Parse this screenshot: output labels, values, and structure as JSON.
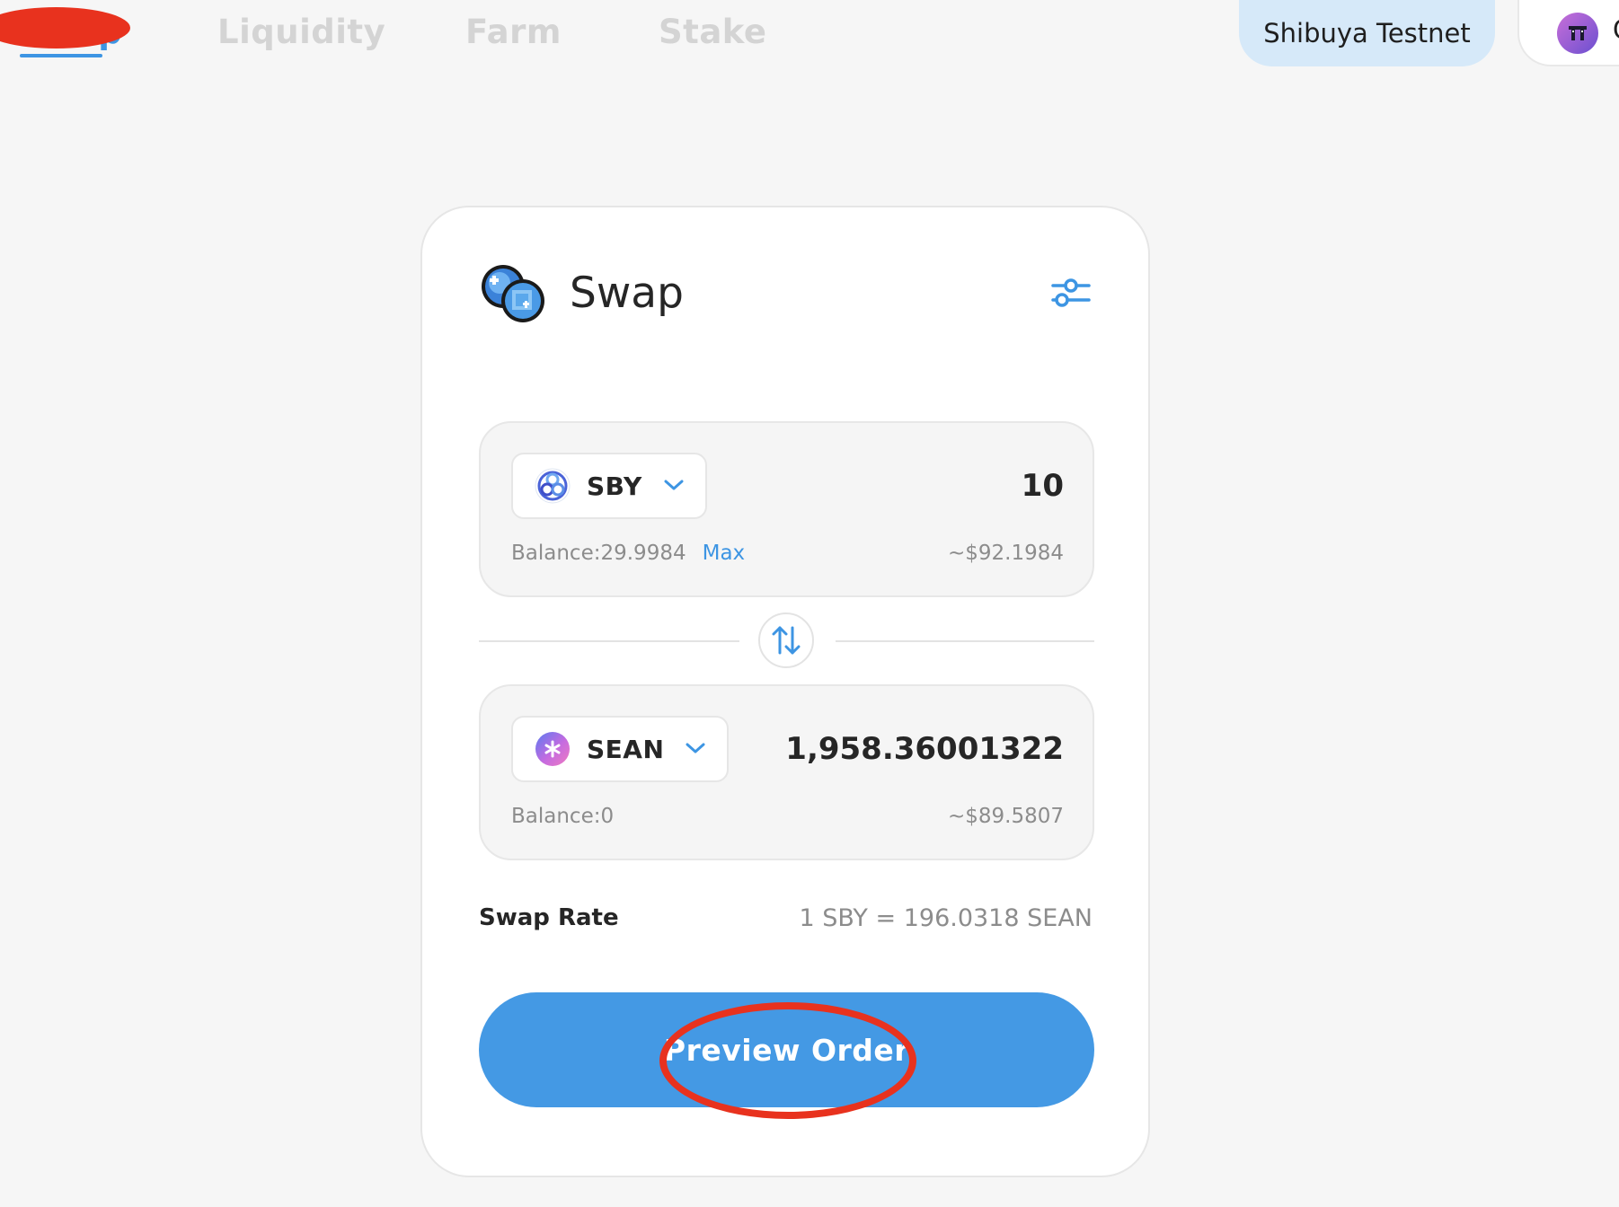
{
  "nav": {
    "tabs": [
      {
        "label": "Swap",
        "active": true
      },
      {
        "label": "Liquidity",
        "active": false
      },
      {
        "label": "Farm",
        "active": false
      },
      {
        "label": "Stake",
        "active": false
      }
    ],
    "network_label": "Shibuya Testnet",
    "wallet_label": "C"
  },
  "swap": {
    "title": "Swap",
    "from": {
      "symbol": "SBY",
      "amount": "10",
      "balance": "Balance:29.9984",
      "max_label": "Max",
      "usd_value": "~$92.1984"
    },
    "to": {
      "symbol": "SEAN",
      "amount": "1,958.36001322",
      "balance": "Balance:0",
      "usd_value": "~$89.5807"
    },
    "rate_label": "Swap Rate",
    "rate_value": "1 SBY = 196.0318 SEAN",
    "preview_button": "Preview Order"
  },
  "icons": {
    "settings": "sliders-icon",
    "flip": "swap-arrows-icon",
    "chevron": "chevron-down-icon",
    "sby": "shiden-token-icon",
    "sean": "sean-token-icon"
  },
  "colors": {
    "accent": "#3d95e3",
    "button": "#4499e4",
    "annotation": "#e8321e",
    "network_bg": "#d6e9f9"
  }
}
